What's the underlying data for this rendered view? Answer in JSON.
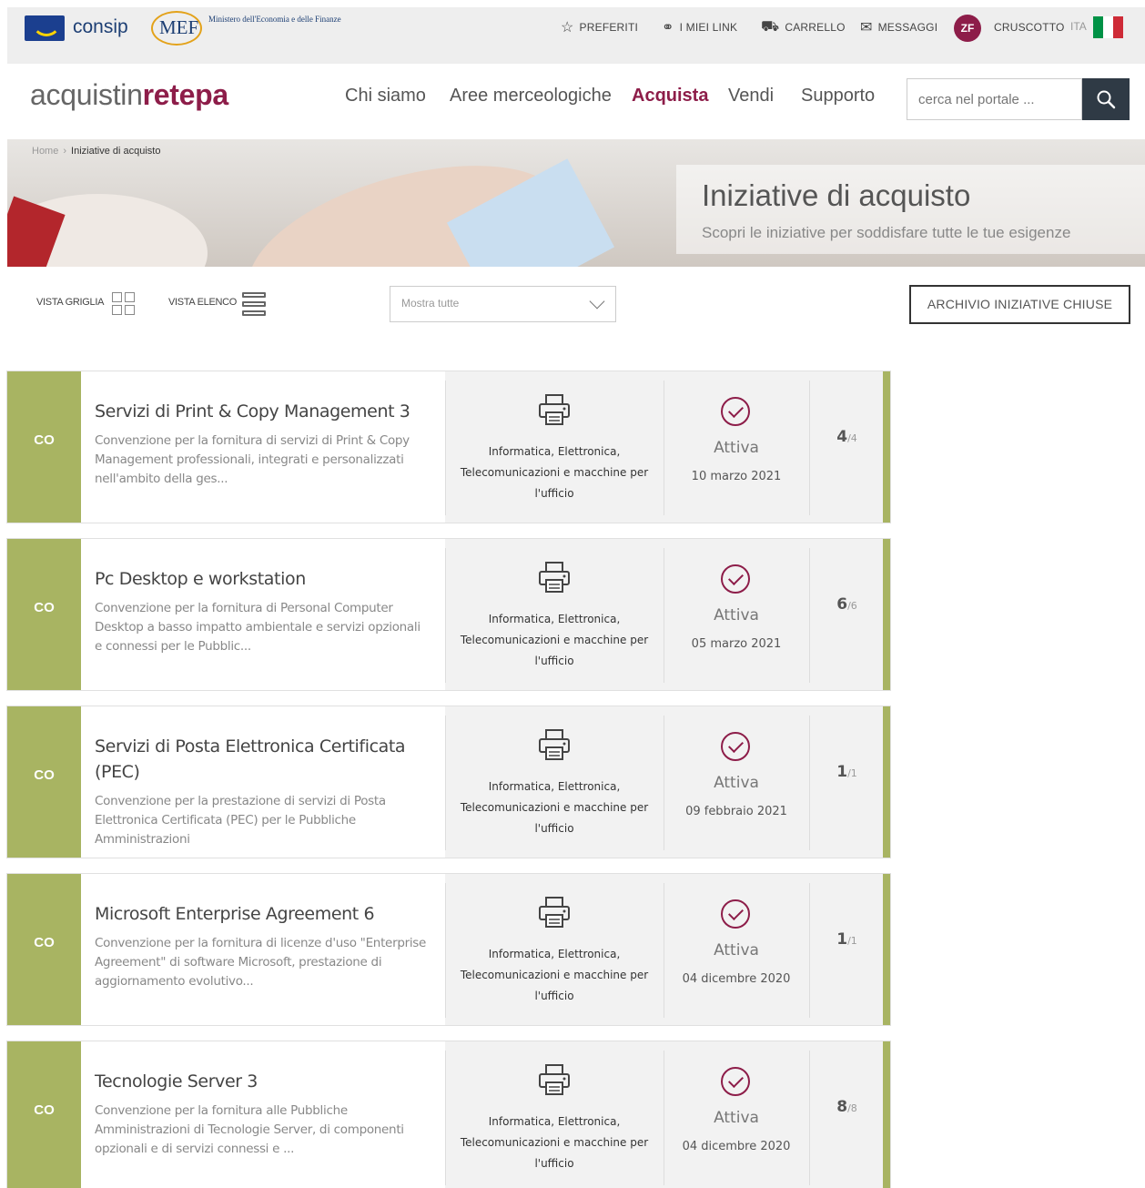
{
  "topbar": {
    "consip": "consip",
    "mef": "MEF",
    "mef_ministry": "Ministero dell'Economia e delle Finanze",
    "links": [
      {
        "icon": "star-icon",
        "glyph": "☆",
        "label": "PREFERITI"
      },
      {
        "icon": "link-icon",
        "glyph": "⚭",
        "label": "I MIEI LINK"
      },
      {
        "icon": "cart-icon",
        "glyph": "⛟",
        "label": "CARRELLO"
      },
      {
        "icon": "envelope-icon",
        "glyph": "✉",
        "label": "MESSAGGI"
      }
    ],
    "avatar": "ZF",
    "dashboard": "CRUSCOTTO",
    "lang": "ITA",
    "flag_colors": [
      "#009246",
      "#ffffff",
      "#ce2b37"
    ]
  },
  "header": {
    "brand_a": "acquistin",
    "brand_b": "rete",
    "brand_c": "pa",
    "nav": [
      "Chi siamo",
      "Aree merceologiche",
      "Acquista",
      "Vendi",
      "Supporto"
    ],
    "active": "Acquista",
    "search_placeholder": "cerca nel portale ..."
  },
  "breadcrumb": {
    "home": "Home",
    "current": "Iniziative di acquisto"
  },
  "hero": {
    "title": "Iniziative di acquisto",
    "subtitle": "Scopri le iniziative per soddisfare tutte le tue esigenze"
  },
  "toolbar": {
    "grid_label": "VISTA GRIGLIA",
    "list_label": "VISTA ELENCO",
    "filter_value": "Mostra tutte",
    "archive_label": "ARCHIVIO INIZIATIVE CHIUSE"
  },
  "colors": {
    "accent": "#8d1d49",
    "tag_green": "#a8b462",
    "dark": "#2f3a45"
  },
  "initiatives": [
    {
      "tag": "CO",
      "title": "Servizi di Print & Copy Management 3",
      "description": "Convenzione per la fornitura di servizi di Print & Copy Management professionali, integrati e personalizzati nell'ambito della ges...",
      "category": "Informatica, Elettronica, Telecomunicazioni e macchine per l'ufficio",
      "status": "Attiva",
      "date": "10 marzo 2021",
      "lots": "4",
      "lots_total": "/4"
    },
    {
      "tag": "CO",
      "title": "Pc Desktop e workstation",
      "description": "Convenzione per la fornitura di Personal Computer Desktop a basso impatto ambientale e servizi opzionali e connessi per le Pubblic...",
      "category": "Informatica, Elettronica, Telecomunicazioni e macchine per l'ufficio",
      "status": "Attiva",
      "date": "05 marzo 2021",
      "lots": "6",
      "lots_total": "/6"
    },
    {
      "tag": "CO",
      "title": "Servizi di Posta Elettronica Certificata (PEC)",
      "description": "Convenzione per la prestazione di servizi di Posta Elettronica Certificata (PEC) per le Pubbliche Amministrazioni",
      "category": "Informatica, Elettronica, Telecomunicazioni e macchine per l'ufficio",
      "status": "Attiva",
      "date": "09 febbraio 2021",
      "lots": "1",
      "lots_total": "/1"
    },
    {
      "tag": "CO",
      "title": "Microsoft Enterprise Agreement 6",
      "description": "Convenzione per la fornitura di licenze d'uso \"Enterprise Agreement\" di software Microsoft, prestazione di aggiornamento evolutivo...",
      "category": "Informatica, Elettronica, Telecomunicazioni e macchine per l'ufficio",
      "status": "Attiva",
      "date": "04 dicembre 2020",
      "lots": "1",
      "lots_total": "/1"
    },
    {
      "tag": "CO",
      "title": "Tecnologie Server 3",
      "description": "Convenzione per la fornitura alle Pubbliche Amministrazioni di Tecnologie Server, di componenti opzionali e di servizi connessi e ...",
      "category": "Informatica, Elettronica, Telecomunicazioni e macchine per l'ufficio",
      "status": "Attiva",
      "date": "04 dicembre 2020",
      "lots": "8",
      "lots_total": "/8"
    }
  ]
}
